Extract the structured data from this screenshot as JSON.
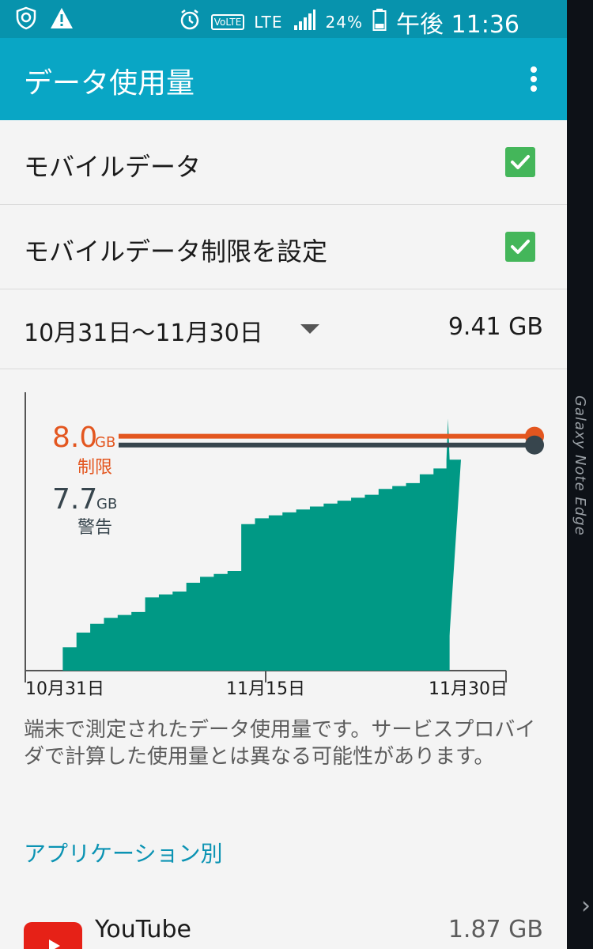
{
  "status": {
    "battery": "24%",
    "time": "午後 11:36",
    "network": "LTE",
    "volte": "VoLTE"
  },
  "appbar": {
    "title": "データ使用量"
  },
  "settings": {
    "mobile_data": {
      "label": "モバイルデータ",
      "checked": true
    },
    "mobile_limit": {
      "label": "モバイルデータ制限を設定",
      "checked": true
    }
  },
  "period": {
    "range": "10月31日～11月30日",
    "total": "9.41 GB"
  },
  "chart_data": {
    "type": "area",
    "x_tick_labels": [
      "10月31日",
      "11月15日",
      "11月30日"
    ],
    "cumulative_gb": [
      0.0,
      0.8,
      1.3,
      1.6,
      1.8,
      1.9,
      2.0,
      2.5,
      2.6,
      2.7,
      3.0,
      3.2,
      3.3,
      3.4,
      5.0,
      5.2,
      5.3,
      5.4,
      5.5,
      5.6,
      5.7,
      5.8,
      5.9,
      6.0,
      6.2,
      6.3,
      6.4,
      6.7,
      6.9,
      7.2,
      8.6
    ],
    "limit": {
      "value": "8.0",
      "unit": "GB",
      "label": "制限",
      "color": "#e3561f"
    },
    "warning": {
      "value": "7.7",
      "unit": "GB",
      "label": "警告",
      "color": "#37454d"
    },
    "fill_color": "#009985",
    "ylim": [
      0,
      9.5
    ]
  },
  "note": "端末で測定されたデータ使用量です。サービスプロバイダで計算した使用量とは異なる可能性があります。",
  "section_title": "アプリケーション別",
  "apps": [
    {
      "name": "YouTube",
      "usage": "1.87 GB"
    }
  ],
  "edge": {
    "device_text": "Galaxy Note Edge"
  }
}
